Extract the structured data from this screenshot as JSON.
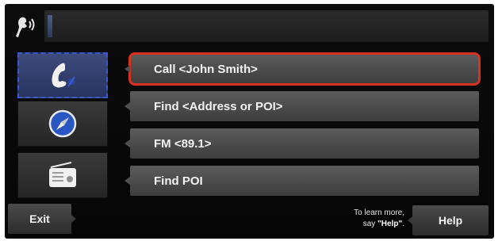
{
  "options": [
    {
      "label": "Call <John Smith>",
      "selected": true
    },
    {
      "label": "Find <Address or POI>",
      "selected": false
    },
    {
      "label": "FM <89.1>",
      "selected": false
    },
    {
      "label": "Find POI",
      "selected": false
    }
  ],
  "categories": [
    {
      "name": "phone",
      "icon": "phone-icon",
      "active": true
    },
    {
      "name": "navigation",
      "icon": "compass-icon",
      "active": false
    },
    {
      "name": "radio",
      "icon": "radio-icon",
      "active": false
    }
  ],
  "bottom": {
    "exit_label": "Exit",
    "help_label": "Help",
    "hint_line1": "To learn more,",
    "hint_line2_prefix": "say ",
    "hint_keyword": "\"Help\"",
    "hint_line2_suffix": "."
  },
  "colors": {
    "selection_outline": "#d7321f",
    "active_category": "#3d58c8"
  }
}
